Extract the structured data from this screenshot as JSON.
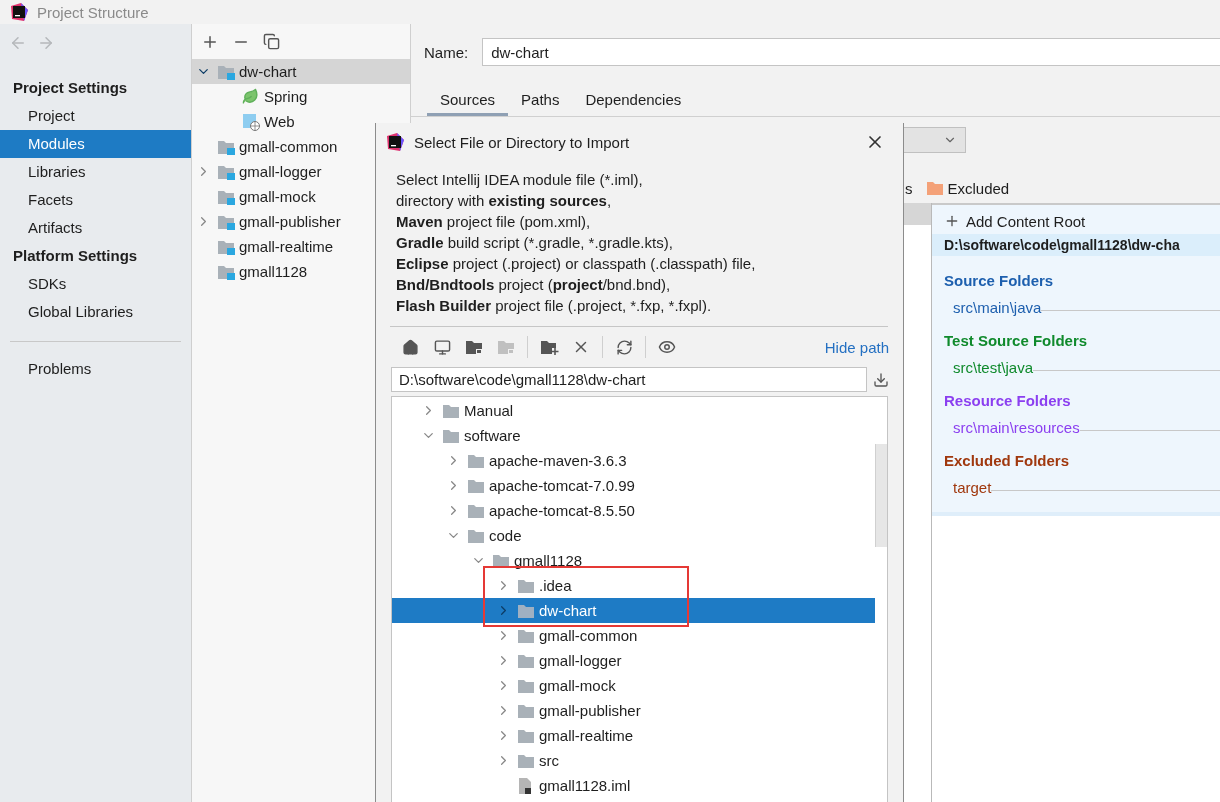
{
  "window": {
    "title": "Project Structure"
  },
  "sidebar": {
    "sections": [
      {
        "title": "Project Settings",
        "items": [
          {
            "label": "Project",
            "selected": false
          },
          {
            "label": "Modules",
            "selected": true
          },
          {
            "label": "Libraries",
            "selected": false
          },
          {
            "label": "Facets",
            "selected": false
          },
          {
            "label": "Artifacts",
            "selected": false
          }
        ]
      },
      {
        "title": "Platform Settings",
        "items": [
          {
            "label": "SDKs",
            "selected": false
          },
          {
            "label": "Global Libraries",
            "selected": false
          }
        ]
      }
    ],
    "footer_items": [
      {
        "label": "Problems",
        "selected": false
      }
    ]
  },
  "modules": {
    "tree": [
      {
        "label": "dw-chart",
        "kind": "module",
        "expandable": true,
        "expanded": true,
        "selected": true,
        "children": [
          {
            "label": "Spring",
            "kind": "spring",
            "expandable": false,
            "selected": false
          },
          {
            "label": "Web",
            "kind": "web",
            "expandable": false,
            "selected": false
          }
        ]
      },
      {
        "label": "gmall-common",
        "kind": "module",
        "expandable": false,
        "selected": false
      },
      {
        "label": "gmall-logger",
        "kind": "module",
        "expandable": true,
        "expanded": false,
        "selected": false
      },
      {
        "label": "gmall-mock",
        "kind": "module",
        "expandable": false,
        "selected": false
      },
      {
        "label": "gmall-publisher",
        "kind": "module",
        "expandable": true,
        "expanded": false,
        "selected": false
      },
      {
        "label": "gmall-realtime",
        "kind": "module",
        "expandable": false,
        "selected": false
      },
      {
        "label": "gmall1128",
        "kind": "module",
        "expandable": false,
        "selected": false
      }
    ]
  },
  "module_settings": {
    "name_label": "Name:",
    "name_value": "dw-chart",
    "tabs": [
      {
        "label": "Sources",
        "selected": true
      },
      {
        "label": "Paths",
        "selected": false
      },
      {
        "label": "Dependencies",
        "selected": false
      }
    ],
    "mark_as_cut": "s",
    "excluded_label": "Excluded",
    "add_content_root": "Add Content Root",
    "content_root_path": "D:\\software\\code\\gmall1128\\dw-cha",
    "folder_groups": [
      {
        "title": "Source Folders",
        "color": "#1d5fae",
        "entries": [
          "src\\main\\java"
        ]
      },
      {
        "title": "Test Source Folders",
        "color": "#0f8a2c",
        "entries": [
          "src\\test\\java"
        ]
      },
      {
        "title": "Resource Folders",
        "color": "#8b3ff0",
        "entries": [
          "src\\main\\resources"
        ]
      },
      {
        "title": "Excluded Folders",
        "color": "#a0380e",
        "entries": [
          "target"
        ]
      }
    ]
  },
  "dialog": {
    "title": "Select File or Directory to Import",
    "description": [
      [
        {
          "kind": "plain",
          "text": "Select Intellij IDEA module file (*.iml),"
        }
      ],
      [
        {
          "kind": "plain",
          "text": "directory with "
        },
        {
          "kind": "bold",
          "text": "existing sources"
        },
        {
          "kind": "plain",
          "text": ","
        }
      ],
      [
        {
          "kind": "bold",
          "text": "Maven"
        },
        {
          "kind": "plain",
          "text": " project file (pom.xml),"
        }
      ],
      [
        {
          "kind": "bold",
          "text": "Gradle"
        },
        {
          "kind": "plain",
          "text": " build script (*.gradle, *.gradle.kts),"
        }
      ],
      [
        {
          "kind": "bold",
          "text": "Eclipse"
        },
        {
          "kind": "plain",
          "text": " project (.project) or classpath (.classpath) file,"
        }
      ],
      [
        {
          "kind": "bold",
          "text": "Bnd/Bndtools"
        },
        {
          "kind": "plain",
          "text": " project ("
        },
        {
          "kind": "bold",
          "text": "project"
        },
        {
          "kind": "plain",
          "text": "/bnd.bnd),"
        }
      ],
      [
        {
          "kind": "bold",
          "text": "Flash Builder"
        },
        {
          "kind": "plain",
          "text": " project file (.project, *.fxp, *.fxpl)."
        }
      ]
    ],
    "toolbar_groups": [
      [
        {
          "kind": "home",
          "disabled": false
        },
        {
          "kind": "desktop",
          "disabled": false
        },
        {
          "kind": "module",
          "disabled": false
        },
        {
          "kind": "module",
          "disabled": true
        }
      ],
      [
        {
          "kind": "new-folder",
          "disabled": false
        },
        {
          "kind": "delete",
          "disabled": false
        }
      ],
      [
        {
          "kind": "refresh",
          "disabled": false
        }
      ],
      [
        {
          "kind": "show-hidden",
          "disabled": false
        }
      ]
    ],
    "hide_path": "Hide path",
    "path": "D:\\software\\code\\gmall1128\\dw-chart",
    "tree": [
      {
        "label": "Manual",
        "kind": "folder",
        "expandable": true,
        "expanded": false,
        "selected": false
      },
      {
        "label": "software",
        "kind": "folder",
        "expandable": true,
        "expanded": true,
        "selected": false,
        "children": [
          {
            "label": "apache-maven-3.6.3",
            "kind": "folder",
            "expandable": true,
            "expanded": false,
            "selected": false
          },
          {
            "label": "apache-tomcat-7.0.99",
            "kind": "folder",
            "expandable": true,
            "expanded": false,
            "selected": false
          },
          {
            "label": "apache-tomcat-8.5.50",
            "kind": "folder",
            "expandable": true,
            "expanded": false,
            "selected": false
          },
          {
            "label": "code",
            "kind": "folder",
            "expandable": true,
            "expanded": true,
            "selected": false,
            "children": [
              {
                "label": "gmall1128",
                "kind": "folder",
                "expandable": true,
                "expanded": true,
                "selected": false,
                "children": [
                  {
                    "label": ".idea",
                    "kind": "folder",
                    "expandable": true,
                    "expanded": false,
                    "selected": false
                  },
                  {
                    "label": "dw-chart",
                    "kind": "folder",
                    "expandable": true,
                    "expanded": false,
                    "selected": true
                  },
                  {
                    "label": "gmall-common",
                    "kind": "folder",
                    "expandable": true,
                    "expanded": false,
                    "selected": false
                  },
                  {
                    "label": "gmall-logger",
                    "kind": "folder",
                    "expandable": true,
                    "expanded": false,
                    "selected": false
                  },
                  {
                    "label": "gmall-mock",
                    "kind": "folder",
                    "expandable": true,
                    "expanded": false,
                    "selected": false
                  },
                  {
                    "label": "gmall-publisher",
                    "kind": "folder",
                    "expandable": true,
                    "expanded": false,
                    "selected": false
                  },
                  {
                    "label": "gmall-realtime",
                    "kind": "folder",
                    "expandable": true,
                    "expanded": false,
                    "selected": false
                  },
                  {
                    "label": "src",
                    "kind": "folder",
                    "expandable": true,
                    "expanded": false,
                    "selected": false
                  },
                  {
                    "label": "gmall1128.iml",
                    "kind": "file",
                    "expandable": false,
                    "selected": false
                  }
                ]
              }
            ]
          }
        ]
      }
    ]
  }
}
